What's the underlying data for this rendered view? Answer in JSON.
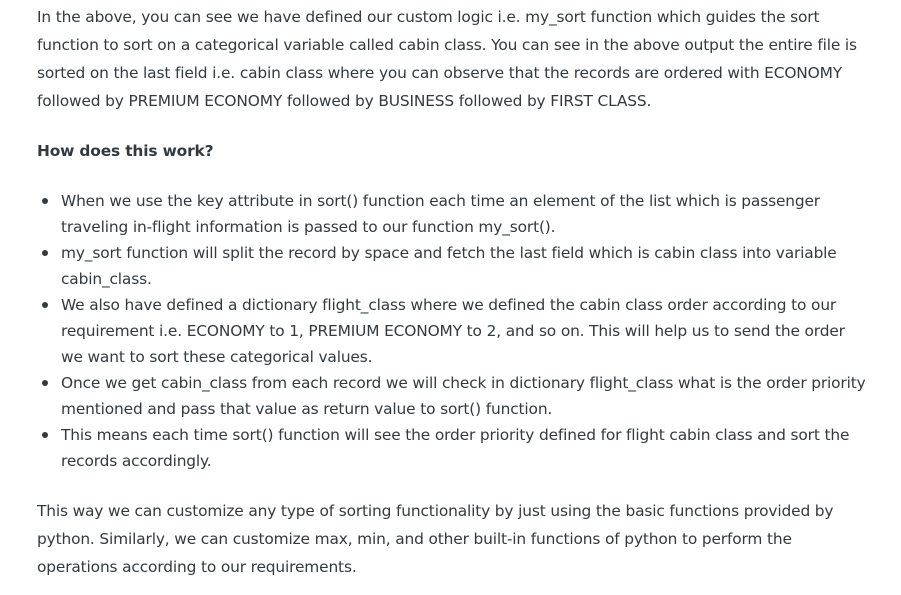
{
  "article": {
    "intro": "In the above, you can see we have defined our custom logic i.e. my_sort function which guides the sort function to sort on a categorical variable called cabin class. You can see in the above output the entire file is sorted on the last field i.e. cabin class where you can observe that the records are ordered with ECONOMY followed by PREMIUM ECONOMY followed by BUSINESS followed by FIRST CLASS.",
    "heading": "How does this work?",
    "bullets": [
      "When we use the key attribute in sort() function each time an element of the list which is passenger traveling in-flight information is passed to our function my_sort().",
      "my_sort function will split the record by space and fetch the last field which is cabin class into variable cabin_class.",
      "We also have defined a dictionary flight_class where we defined the cabin class order according to our requirement i.e. ECONOMY to 1, PREMIUM ECONOMY to 2, and so on. This will help us to send the order we want to sort these categorical values.",
      "Once we get cabin_class from each record we will check in dictionary flight_class what is the order priority mentioned and pass that value as return value to sort() function.",
      "This means each time sort() function will see the order priority defined for flight cabin class and sort the records accordingly."
    ],
    "outro": "This way we can customize any type of sorting functionality by just using the basic functions provided by python. Similarly, we can customize max, min, and other built-in functions of python to perform the operations according to our requirements."
  }
}
